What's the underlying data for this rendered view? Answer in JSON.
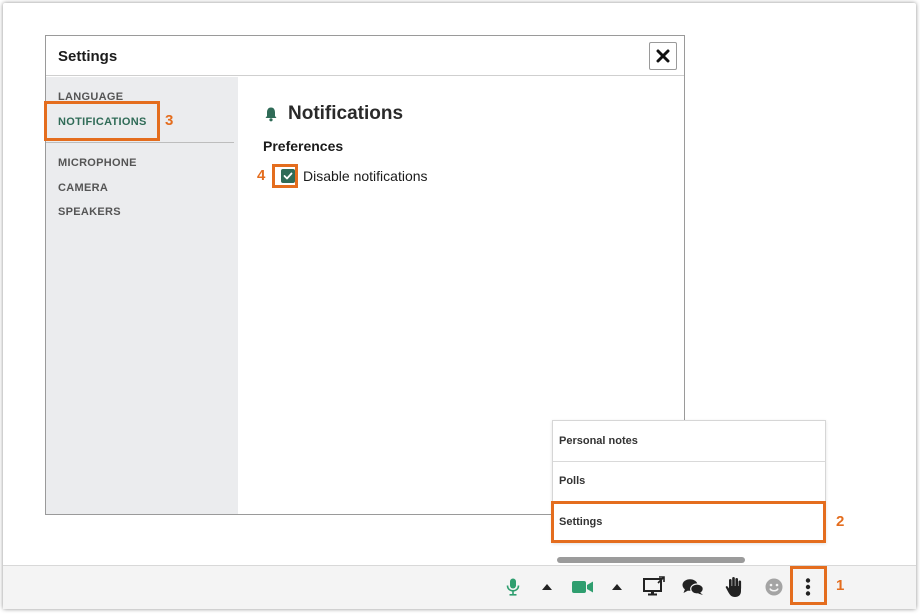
{
  "modal": {
    "title": "Settings",
    "close_icon": "close-icon"
  },
  "sidebar": {
    "items": [
      {
        "label": "LANGUAGE"
      },
      {
        "label": "NOTIFICATIONS",
        "active": true
      },
      {
        "label": "MICROPHONE"
      },
      {
        "label": "CAMERA"
      },
      {
        "label": "SPEAKERS"
      }
    ]
  },
  "content": {
    "title": "Notifications",
    "title_icon": "bell-icon",
    "section": "Preferences",
    "checkbox": {
      "label": "Disable notifications",
      "checked": true
    }
  },
  "menu": {
    "items": [
      {
        "label": "Personal notes"
      },
      {
        "label": "Polls"
      },
      {
        "label": "Settings"
      }
    ]
  },
  "toolbar": {
    "buttons": [
      {
        "icon": "microphone-icon"
      },
      {
        "icon": "caret-up-icon"
      },
      {
        "icon": "video-camera-icon"
      },
      {
        "icon": "caret-up-icon"
      },
      {
        "icon": "screen-share-icon"
      },
      {
        "icon": "chat-icon"
      },
      {
        "icon": "raise-hand-icon"
      },
      {
        "icon": "emoji-icon"
      },
      {
        "icon": "more-vertical-icon"
      }
    ]
  },
  "annotations": [
    "1",
    "2",
    "3",
    "4"
  ],
  "colors": {
    "accent": "#2f6b57",
    "highlight": "#e46d1e"
  }
}
